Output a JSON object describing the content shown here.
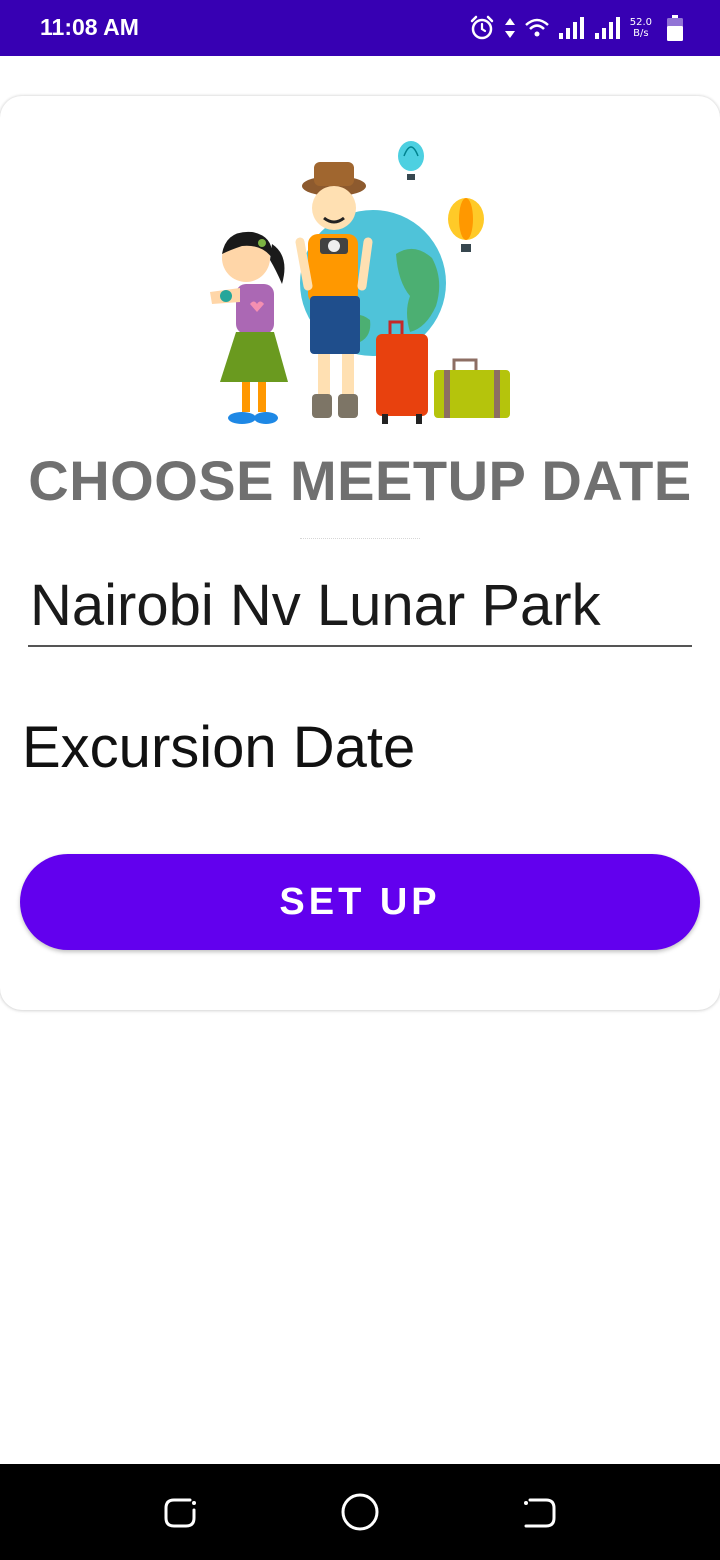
{
  "status_bar": {
    "time": "11:08 AM",
    "net_speed_value": "52.0",
    "net_speed_unit": "B/s",
    "icons": [
      "alarm-icon",
      "data-arrows-icon",
      "wifi-icon",
      "signal-icon",
      "signal-icon",
      "battery-icon"
    ]
  },
  "main": {
    "title": "CHOOSE MEETUP DATE",
    "location_value": "Nairobi Nv Lunar Park",
    "date_label": "Excursion Date",
    "setup_button_label": "SET UP"
  },
  "colors": {
    "status_bar": "#3700b3",
    "accent": "#6200ee",
    "title_gray": "#707070"
  },
  "nav_bar": {
    "icons": [
      "recent-apps-icon",
      "home-icon",
      "back-icon"
    ]
  }
}
